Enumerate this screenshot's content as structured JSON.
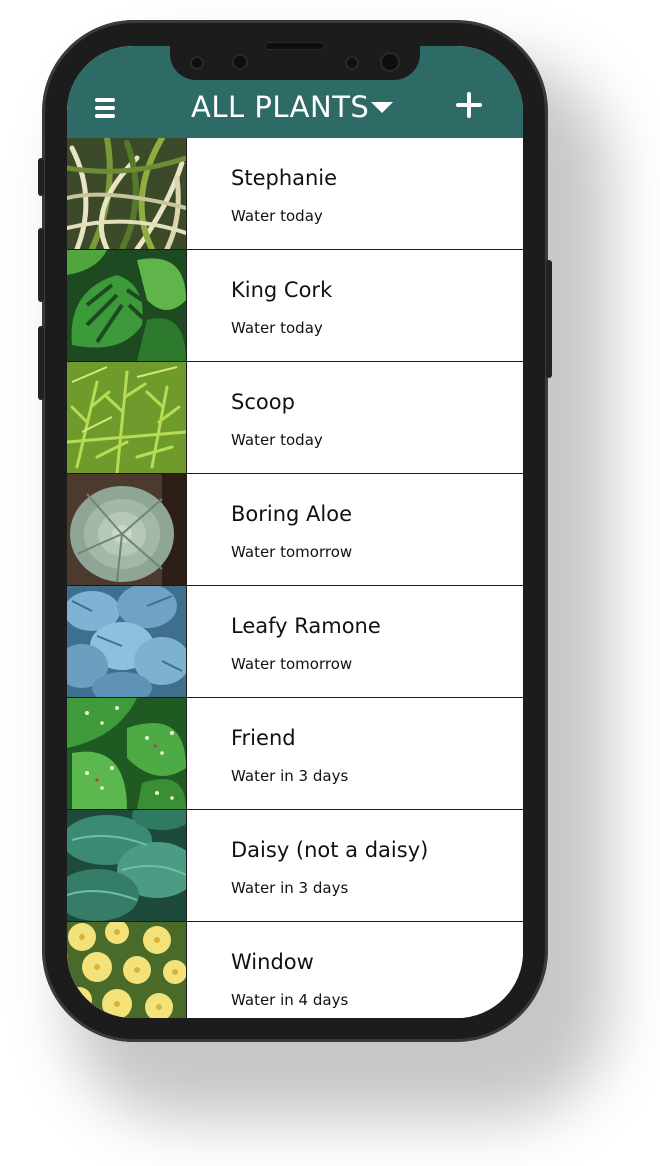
{
  "header": {
    "title": "ALL PLANTS",
    "menu_icon": "hamburger-menu-icon",
    "dropdown_icon": "chevron-down-icon",
    "add_icon": "plus-icon",
    "background_color": "#2f6b66"
  },
  "plants": [
    {
      "name": "Stephanie",
      "status": "Water today",
      "photo": "striped-grass"
    },
    {
      "name": "King Cork",
      "status": "Water today",
      "photo": "monstera"
    },
    {
      "name": "Scoop",
      "status": "Water today",
      "photo": "feathery-fern"
    },
    {
      "name": "Boring Aloe",
      "status": "Water tomorrow",
      "photo": "succulent"
    },
    {
      "name": "Leafy Ramone",
      "status": "Water tomorrow",
      "photo": "blue-leaves"
    },
    {
      "name": "Friend",
      "status": "Water in 3 days",
      "photo": "speckled-caladium"
    },
    {
      "name": "Daisy (not a daisy)",
      "status": "Water in 3 days",
      "photo": "hosta"
    },
    {
      "name": "Window",
      "status": "Water in 4 days",
      "photo": "yellow-flowers"
    }
  ]
}
